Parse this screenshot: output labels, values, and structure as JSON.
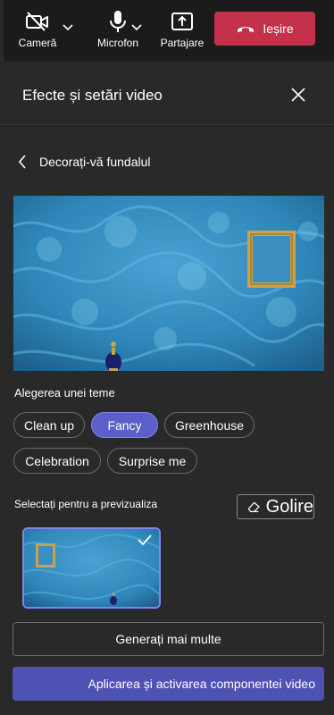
{
  "toolbar": {
    "camera_label": "Cameră",
    "mic_label": "Microfon",
    "share_label": "Partajare",
    "leave_label": "Ieșire"
  },
  "panel": {
    "title": "Efecte și setări video",
    "back_label": "Decorați-vă fundalul"
  },
  "themes": {
    "heading": "Alegerea unei teme",
    "chips": [
      "Clean up",
      "Fancy",
      "Greenhouse",
      "Celebration",
      "Surprise me"
    ],
    "selected": "Fancy"
  },
  "preview_select": {
    "heading": "Selectați pentru a previzualiza",
    "clear_label": "Golire"
  },
  "actions": {
    "generate_label": "Generați mai multe",
    "apply_label": "Aplicarea și activarea componentei video"
  },
  "colors": {
    "accent": "#5b5fc7",
    "leave": "#c4314b",
    "wallpaper": "#3a8fc0"
  }
}
